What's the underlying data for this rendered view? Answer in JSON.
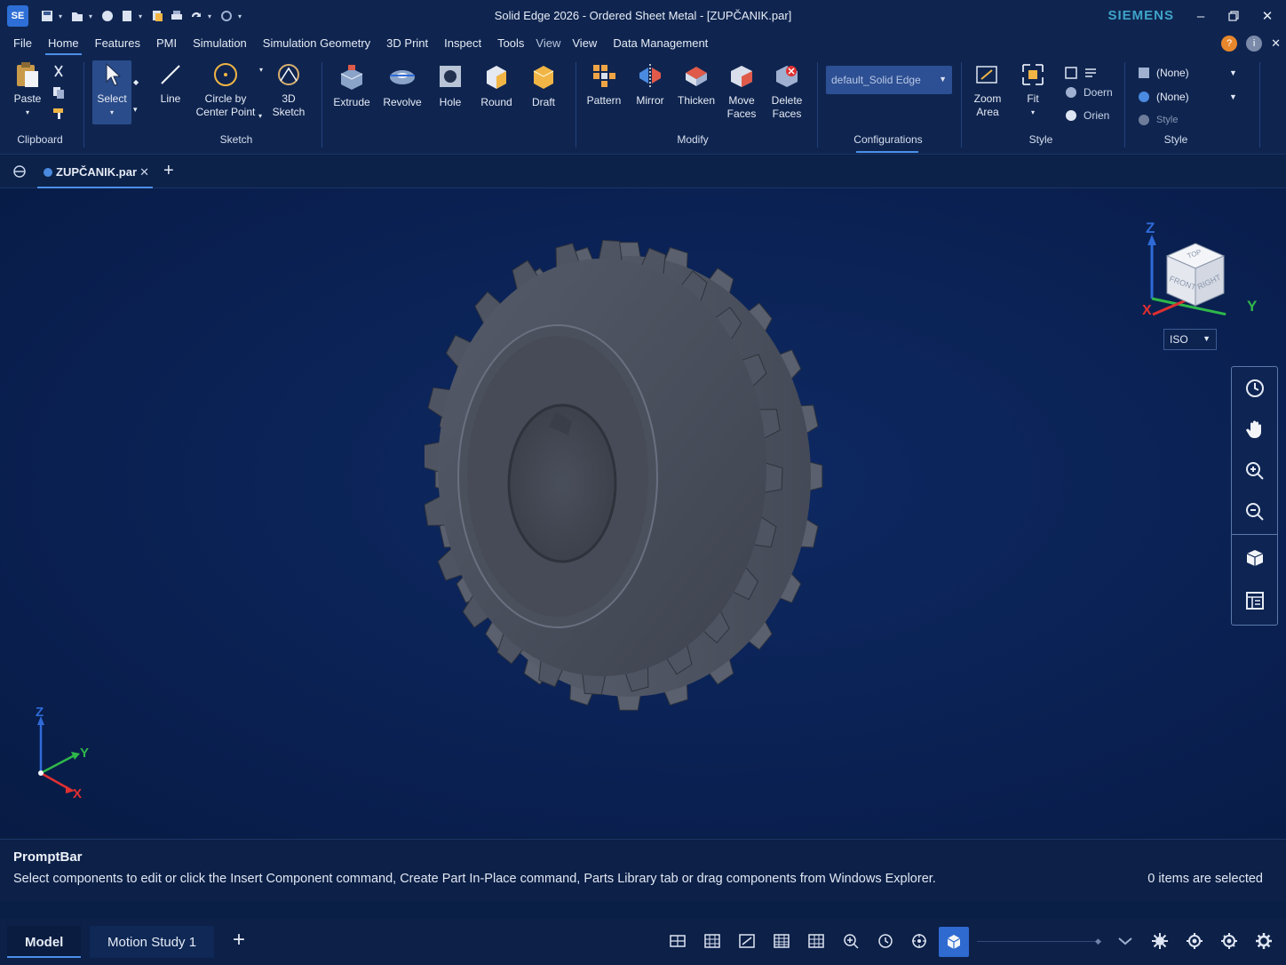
{
  "app": {
    "title": "Solid Edge 2026 - Ordered Sheet Metal - [ZUPČANIK.par]",
    "logo_text": "SE",
    "brand": "SIEMENS"
  },
  "quick_access": [
    "save-icon",
    "open-icon",
    "undo-icon",
    "new-icon",
    "copy-icon",
    "print-icon",
    "redo-icon",
    "options-icon"
  ],
  "menu": {
    "items": [
      "File",
      "Home",
      "Features",
      "PMI",
      "Simulation",
      "Simulation Geometry",
      "3D Print",
      "Inspect",
      "Tools",
      "View",
      "View",
      "Data Management"
    ],
    "active": "Home"
  },
  "ribbon": {
    "clipboard": {
      "label": "Clipboard",
      "paste": "Paste"
    },
    "sketch": {
      "label": "Sketch",
      "select": "Select",
      "line": "Line",
      "circle_line1": "Circle by",
      "circle_line2": "Center Point",
      "sketch3d_line1": "3D",
      "sketch3d_line2": "Sketch"
    },
    "modify": {
      "label": "Modify",
      "extrude": "Extrude",
      "revolve": "Revolve",
      "hole": "Hole",
      "round": "Round",
      "draft": "Draft",
      "pattern": "Pattern",
      "mirror": "Mirror",
      "thicken": "Thicken",
      "move_faces_1": "Move",
      "move_faces_2": "Faces",
      "delete_faces_1": "Delete",
      "delete_faces_2": "Faces"
    },
    "configurations": {
      "label": "Configurations",
      "value": "default_Solid Edge"
    },
    "view": {
      "label": "Style",
      "zoom_area_1": "Zoom",
      "zoom_area_2": "Area",
      "fit": "Fit",
      "small1": "",
      "small2": "Doern",
      "small3": "Orien"
    },
    "style": {
      "label": "Style",
      "face_style": "(None)",
      "edge_style": "(None)",
      "style_btn": "Style"
    }
  },
  "doc_tabs": [
    {
      "label": "ZUPČANIK.par"
    }
  ],
  "viewport": {
    "view_orientation": "ISO",
    "cube_faces": {
      "top": "TOP",
      "front": "FRONT",
      "right": "RIGHT"
    },
    "axes": {
      "x": "X",
      "y": "Y",
      "z": "Z"
    },
    "colors": {
      "x": "#e03030",
      "y": "#2fb84a",
      "z": "#2f6ad8",
      "gear": "#4a4f5c",
      "background": "#0a2153"
    }
  },
  "prompt_bar": {
    "title": "PromptBar",
    "message": "Select components to edit or click the Insert Component command, Create Part In-Place command, Parts Library tab or drag components from Windows Explorer.",
    "status": "0 items are selected"
  },
  "bottom_tabs": [
    {
      "label": "Model",
      "active": true
    },
    {
      "label": "Motion Study 1",
      "active": false
    }
  ]
}
